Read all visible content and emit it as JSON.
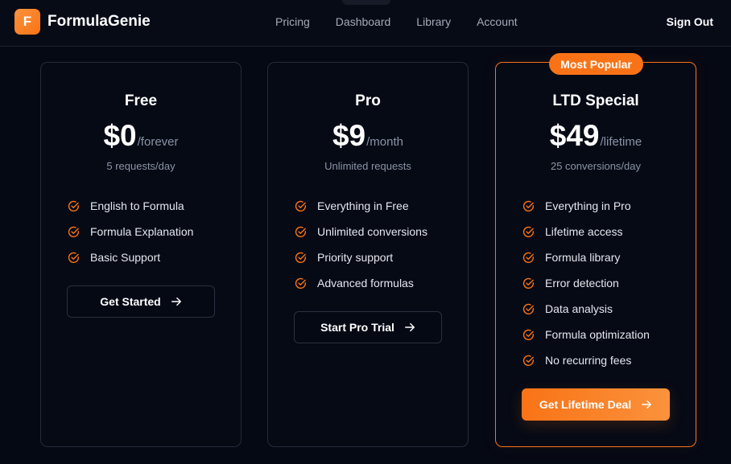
{
  "app": {
    "logo_letter": "F",
    "name": "FormulaGenie"
  },
  "nav": {
    "items": [
      "Pricing",
      "Dashboard",
      "Library",
      "Account"
    ],
    "sign_out": "Sign Out"
  },
  "colors": {
    "accent": "#f97316",
    "background": "#050914"
  },
  "plans": [
    {
      "name": "Free",
      "price": "$0",
      "period": "/forever",
      "subtitle": "5 requests/day",
      "features": [
        "English to Formula",
        "Formula Explanation",
        "Basic Support"
      ],
      "cta": "Get Started"
    },
    {
      "name": "Pro",
      "price": "$9",
      "period": "/month",
      "subtitle": "Unlimited requests",
      "features": [
        "Everything in Free",
        "Unlimited conversions",
        "Priority support",
        "Advanced formulas"
      ],
      "cta": "Start Pro Trial"
    },
    {
      "name": "LTD Special",
      "badge": "Most Popular",
      "price": "$49",
      "period": "/lifetime",
      "subtitle": "25 conversions/day",
      "features": [
        "Everything in Pro",
        "Lifetime access",
        "Formula library",
        "Error detection",
        "Data analysis",
        "Formula optimization",
        "No recurring fees"
      ],
      "cta": "Get Lifetime Deal"
    }
  ]
}
